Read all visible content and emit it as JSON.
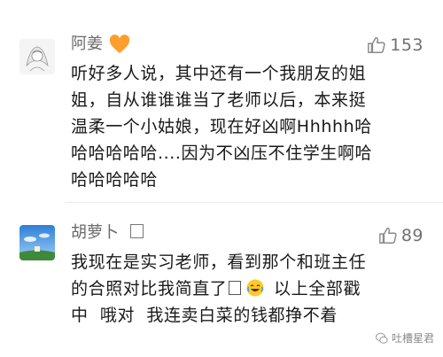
{
  "comments": [
    {
      "name": "阿姜",
      "likes": "153",
      "lines": [
        "听好多人说，其中还有一个我朋友的姐",
        "姐，自从谁谁谁当了老师以后，本来挺",
        "温柔一个小姑娘，现在好凶啊Hhhhh哈",
        "哈哈哈哈哈....因为不凶压不住学生啊哈",
        "哈哈哈哈哈"
      ]
    },
    {
      "name": "胡萝卜",
      "likes": "89",
      "line1": "我现在是实习老师，看到那个和班主任",
      "line2_a": "的合照对比我简直了",
      "line2_b": "以上全部戳",
      "line3": "中  哦对  我连卖白菜的钱都挣不着"
    }
  ],
  "watermark": "吐槽星君",
  "icons": {
    "heart": "orange-heart-icon",
    "like": "thumbs-up-icon",
    "emoji": "laughing-crying-emoji-icon",
    "watermark": "wechat-icon"
  },
  "colors": {
    "heart": "#ff9e2c",
    "like_icon": "#8a8a8a",
    "text": "#1a1a1a",
    "name": "#6b6b6b"
  }
}
